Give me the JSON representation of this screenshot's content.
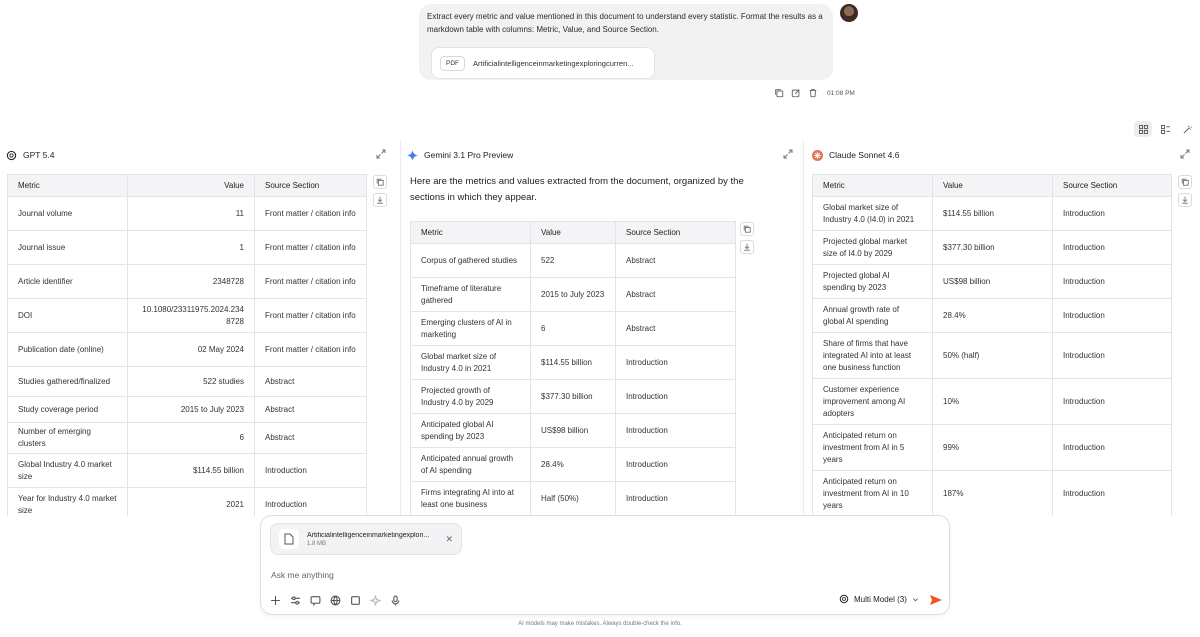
{
  "user_message": {
    "text": "Extract every metric and value mentioned in this document to understand every statistic. Format the results as a markdown table with columns: Metric, Value, and Source Section.",
    "attachment": {
      "badge": "PDF",
      "name": "Artificialintelligenceinmarketingexploringcurren..."
    },
    "time": "01:08 PM"
  },
  "panels": {
    "left": {
      "title": "GPT 5.4",
      "columns": [
        "Metric",
        "Value",
        "Source Section"
      ],
      "rows": [
        {
          "metric": "Journal volume",
          "value": "11",
          "source": "Front matter / citation info"
        },
        {
          "metric": "Journal issue",
          "value": "1",
          "source": "Front matter / citation info"
        },
        {
          "metric": "Article identifier",
          "value": "2348728",
          "source": "Front matter / citation info"
        },
        {
          "metric": "DOI",
          "value": "10.1080/23311975.2024.2348728",
          "source": "Front matter / citation info"
        },
        {
          "metric": "Publication date (online)",
          "value": "02 May 2024",
          "source": "Front matter / citation info"
        },
        {
          "metric": "Studies gathered/finalized",
          "value": "522 studies",
          "source": "Abstract"
        },
        {
          "metric": "Study coverage period",
          "value": "2015 to July 2023",
          "source": "Abstract"
        },
        {
          "metric": "Number of emerging clusters",
          "value": "6",
          "source": "Abstract"
        },
        {
          "metric": "Global Industry 4.0 market size",
          "value": "$114.55 billion",
          "source": "Introduction"
        },
        {
          "metric": "Year for Industry 4.0 market size",
          "value": "2021",
          "source": "Introduction"
        }
      ]
    },
    "mid": {
      "title": "Gemini 3.1 Pro Preview",
      "intro": "Here are the metrics and values extracted from the document, organized by the sections in which they appear.",
      "columns": [
        "Metric",
        "Value",
        "Source Section"
      ],
      "rows": [
        {
          "metric": "Corpus of gathered studies",
          "value": "522",
          "source": "Abstract"
        },
        {
          "metric": "Timeframe of literature gathered",
          "value": "2015 to July 2023",
          "source": "Abstract"
        },
        {
          "metric": "Emerging clusters of AI in marketing",
          "value": "6",
          "source": "Abstract"
        },
        {
          "metric": "Global market size of Industry 4.0 in 2021",
          "value": "$114.55 billion",
          "source": "Introduction"
        },
        {
          "metric": "Projected growth of Industry 4.0 by 2029",
          "value": "$377.30 billion",
          "source": "Introduction"
        },
        {
          "metric": "Anticipated global AI spending by 2023",
          "value": "US$98 billion",
          "source": "Introduction"
        },
        {
          "metric": "Anticipated annual growth of AI spending",
          "value": "28.4%",
          "source": "Introduction"
        },
        {
          "metric": "Firms integrating AI into at least one business",
          "value": "Half (50%)",
          "source": "Introduction"
        }
      ]
    },
    "right": {
      "title": "Claude Sonnet 4.6",
      "columns": [
        "Metric",
        "Value",
        "Source Section"
      ],
      "rows": [
        {
          "metric": "Global market size of Industry 4.0 (I4.0) in 2021",
          "value": "$114.55 billion",
          "source": "Introduction"
        },
        {
          "metric": "Projected global market size of I4.0 by 2029",
          "value": "$377.30 billion",
          "source": "Introduction"
        },
        {
          "metric": "Projected global AI spending by 2023",
          "value": "US$98 billion",
          "source": "Introduction"
        },
        {
          "metric": "Annual growth rate of global AI spending",
          "value": "28.4%",
          "source": "Introduction"
        },
        {
          "metric": "Share of firms that have integrated AI into at least one business function",
          "value": "50% (half)",
          "source": "Introduction"
        },
        {
          "metric": "Customer experience improvement among AI adopters",
          "value": "10%",
          "source": "Introduction"
        },
        {
          "metric": "Anticipated return on investment from AI in 5 years",
          "value": "99%",
          "source": "Introduction"
        },
        {
          "metric": "Anticipated return on investment from AI in 10 years",
          "value": "187%",
          "source": "Introduction"
        }
      ]
    }
  },
  "composer": {
    "file": {
      "name": "Artificialintelligenceinmarketingexplori...",
      "size": "1.8 MB"
    },
    "placeholder": "Ask me anything",
    "model_label": "Multi Model (3)"
  },
  "disclaimer": "AI models may make mistakes. Always double-check the info.",
  "colors": {
    "accent": "#f2541b",
    "panel_border": "#e4e4e8",
    "header_bg": "#f4f4f6"
  }
}
